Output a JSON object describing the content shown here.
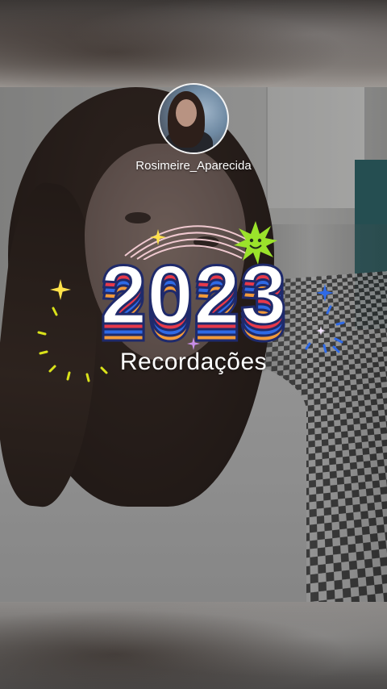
{
  "profile": {
    "username": "Rosimeire_Aparecida"
  },
  "recap": {
    "year": "2023",
    "subtitle": "Recordações"
  },
  "decor": {
    "icons": [
      "sparkle-icon",
      "smiley-star-icon",
      "arcs-icon"
    ],
    "colors": {
      "digit_face": "#ffffff",
      "digit_outline": "#1f2a6b",
      "stripe_red": "#e8394a",
      "stripe_blue": "#2f6ae6",
      "stripe_orange": "#f29a3a",
      "smiley_green": "#9be22b",
      "sparkle_yellow": "#ffe24a",
      "sparkle_blue": "#2f6ae6"
    }
  }
}
